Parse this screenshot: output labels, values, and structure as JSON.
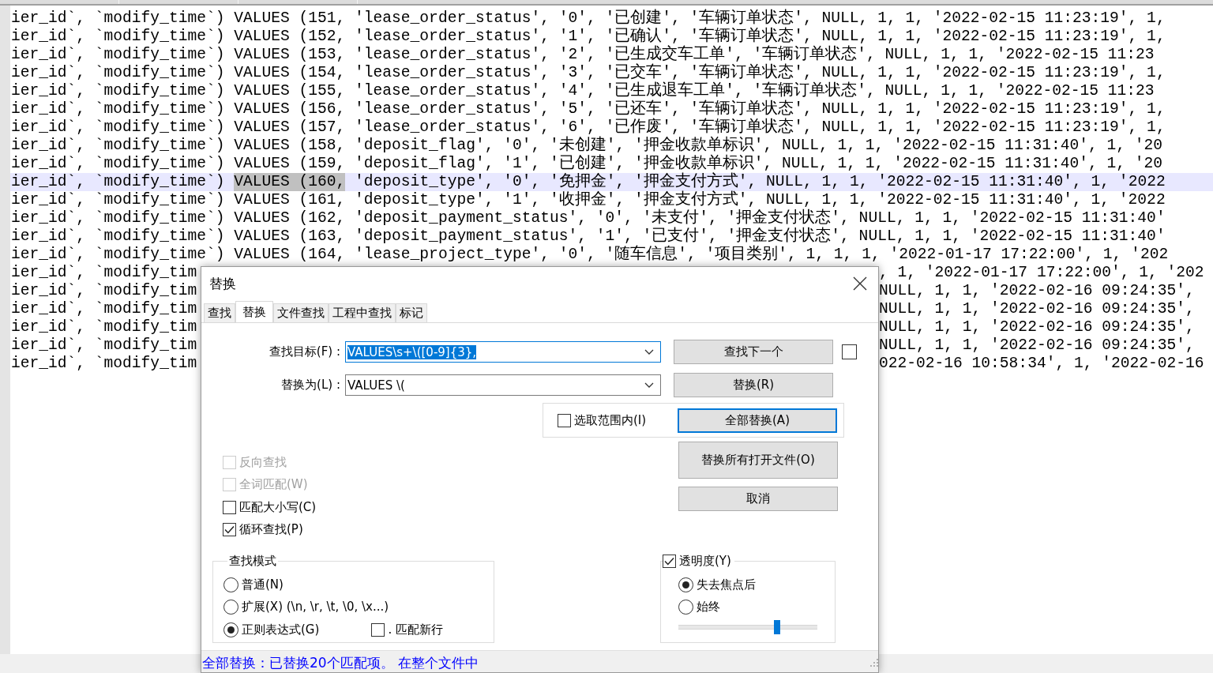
{
  "editor": {
    "lines": [
      {
        "kind": "full",
        "text": "ier_id`, `modify_time`) VALUES (151, 'lease_order_status', '0', '已创建', '车辆订单状态', NULL, 1, 1, '2022-02-15 11:23:19', 1,",
        "current": false
      },
      {
        "kind": "full",
        "text": "ier_id`, `modify_time`) VALUES (152, 'lease_order_status', '1', '已确认', '车辆订单状态', NULL, 1, 1, '2022-02-15 11:23:19', 1,",
        "current": false
      },
      {
        "kind": "full",
        "text": "ier_id`, `modify_time`) VALUES (153, 'lease_order_status', '2', '已生成交车工单', '车辆订单状态', NULL, 1, 1, '2022-02-15 11:23",
        "current": false
      },
      {
        "kind": "full",
        "text": "ier_id`, `modify_time`) VALUES (154, 'lease_order_status', '3', '已交车', '车辆订单状态', NULL, 1, 1, '2022-02-15 11:23:19', 1,",
        "current": false
      },
      {
        "kind": "full",
        "text": "ier_id`, `modify_time`) VALUES (155, 'lease_order_status', '4', '已生成退车工单', '车辆订单状态', NULL, 1, 1, '2022-02-15 11:23",
        "current": false
      },
      {
        "kind": "full",
        "text": "ier_id`, `modify_time`) VALUES (156, 'lease_order_status', '5', '已还车', '车辆订单状态', NULL, 1, 1, '2022-02-15 11:23:19', 1,",
        "current": false
      },
      {
        "kind": "full",
        "text": "ier_id`, `modify_time`) VALUES (157, 'lease_order_status', '6', '已作废', '车辆订单状态', NULL, 1, 1, '2022-02-15 11:23:19', 1,",
        "current": false
      },
      {
        "kind": "full",
        "text": "ier_id`, `modify_time`) VALUES (158, 'deposit_flag', '0', '未创建', '押金收款单标识', NULL, 1, 1, '2022-02-15 11:31:40', 1, '20",
        "current": false
      },
      {
        "kind": "full",
        "text": "ier_id`, `modify_time`) VALUES (159, 'deposit_flag', '1', '已创建', '押金收款单标识', NULL, 1, 1, '2022-02-15 11:31:40', 1, '20",
        "current": false
      },
      {
        "kind": "found",
        "before": "ier_id`, `modify_time`) ",
        "match": "VALUES (160,",
        "after": " 'deposit_type', '0', '免押金', '押金支付方式', NULL, 1, 1, '2022-02-15 11:31:40', 1, '2022",
        "current": true
      },
      {
        "kind": "full",
        "text": "ier_id`, `modify_time`) VALUES (161, 'deposit_type', '1', '收押金', '押金支付方式', NULL, 1, 1, '2022-02-15 11:31:40', 1, '2022",
        "current": false
      },
      {
        "kind": "full",
        "text": "ier_id`, `modify_time`) VALUES (162, 'deposit_payment_status', '0', '未支付', '押金支付状态', NULL, 1, 1, '2022-02-15 11:31:40'",
        "current": false
      },
      {
        "kind": "full",
        "text": "ier_id`, `modify_time`) VALUES (163, 'deposit_payment_status', '1', '已支付', '押金支付状态', NULL, 1, 1, '2022-02-15 11:31:40'",
        "current": false
      },
      {
        "kind": "full",
        "text": "ier_id`, `modify_time`) VALUES (164, 'lease_project_type', '0', '随车信息', '项目类别', 1, 1, 1, '2022-01-17 17:22:00', 1, '202",
        "current": false
      },
      {
        "kind": "covered",
        "left": "ier_id`, `modify_tim",
        "right": ", 1, '2022-01-17 17:22:00', 1, '202",
        "current": false
      },
      {
        "kind": "covered",
        "left": "ier_id`, `modify_tim",
        "right": "NULL, 1, 1, '2022-02-16 09:24:35',",
        "current": false
      },
      {
        "kind": "covered",
        "left": "ier_id`, `modify_tim",
        "right": "NULL, 1, 1, '2022-02-16 09:24:35',",
        "current": false
      },
      {
        "kind": "covered",
        "left": "ier_id`, `modify_tim",
        "right": "NULL, 1, 1, '2022-02-16 09:24:35',",
        "current": false
      },
      {
        "kind": "covered",
        "left": "ier_id`, `modify_tim",
        "right": "NULL, 1, 1, '2022-02-16 09:24:35',",
        "current": false
      },
      {
        "kind": "covered",
        "left": "ier_id`, `modify_tim",
        "right": "022-02-16 10:58:34', 1, '2022-02-16",
        "current": false
      }
    ]
  },
  "dialog": {
    "title": "替换",
    "tabs": [
      {
        "label": "查找",
        "selected": false
      },
      {
        "label": "替换",
        "selected": true
      },
      {
        "label": "文件查找",
        "selected": false
      },
      {
        "label": "工程中查找",
        "selected": false
      },
      {
        "label": "标记",
        "selected": false
      }
    ],
    "find": {
      "label": "查找目标(F) :",
      "value": "VALUES\\s+\\([0-9]{3},",
      "text_selected": true
    },
    "replace": {
      "label": "替换为(L) :",
      "value": "VALUES \\(",
      "text_selected": false
    },
    "find_next": {
      "label": "查找下一个",
      "default": false
    },
    "side_checkbox": {
      "checked": false
    },
    "replace_one": {
      "label": "替换(R)",
      "default": false
    },
    "in_selection": {
      "label": "选取范围内(I)",
      "checked": false
    },
    "replace_all": {
      "label": "全部替换(A)",
      "default": true
    },
    "replace_all_open": {
      "label": "替换所有打开文件(O)",
      "default": false
    },
    "cancel": {
      "label": "取消",
      "default": false
    },
    "options": [
      {
        "label": "反向查找",
        "checked": false,
        "disabled": true
      },
      {
        "label": "全词匹配(W)",
        "checked": false,
        "disabled": true
      },
      {
        "label": "匹配大小写(C)",
        "checked": false,
        "disabled": false
      },
      {
        "label": "循环查找(P)",
        "checked": true,
        "disabled": false
      }
    ],
    "search_mode": {
      "title": "查找模式",
      "modes": [
        {
          "label": "普通(N)",
          "selected": false
        },
        {
          "label": "扩展(X) (\\n, \\r, \\t, \\0, \\x...)",
          "selected": false
        },
        {
          "label": "正则表达式(G)",
          "selected": true
        }
      ],
      "dot_newline": {
        "label": ". 匹配新行",
        "checked": false
      }
    },
    "transparency": {
      "label": "透明度(Y)",
      "checked": true,
      "modes": [
        {
          "label": "失去焦点后",
          "selected": true
        },
        {
          "label": "始终",
          "selected": false
        }
      ],
      "level": 0.71
    },
    "status": "全部替换：已替换20个匹配项。 在整个文件中"
  }
}
